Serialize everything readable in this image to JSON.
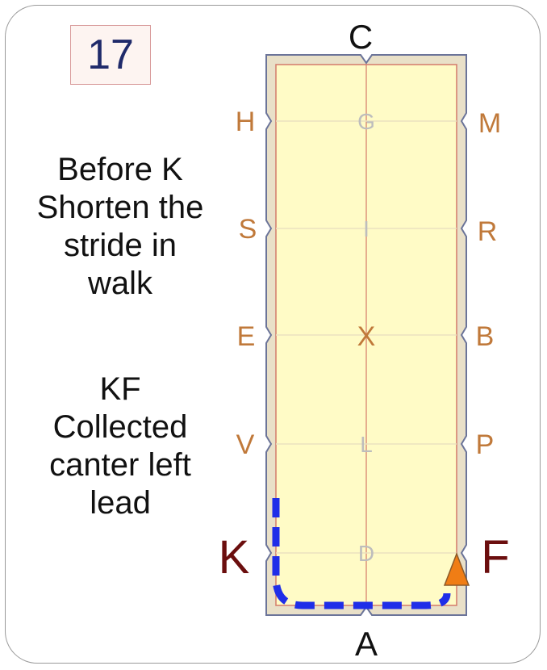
{
  "step_number": "17",
  "instructions": [
    {
      "lines": [
        "Before K",
        "Shorten the",
        "stride in",
        "walk"
      ]
    },
    {
      "lines": [
        "KF",
        "Collected",
        "canter left",
        "lead"
      ]
    }
  ],
  "arena": {
    "letters": {
      "top": "C",
      "bottom": "A",
      "left": [
        "H",
        "S",
        "E",
        "V",
        "K"
      ],
      "right": [
        "M",
        "R",
        "B",
        "P",
        "F"
      ],
      "centerline": [
        "G",
        "I",
        "X",
        "L",
        "D"
      ]
    },
    "colors": {
      "surface": "#fffbc6",
      "border": "#e9e0c8",
      "letter": "#c0793a",
      "corner_letter": "#6b0e0e",
      "centerline_letter": "#bdbdbd",
      "path": "#1f2ee8",
      "marker": "#f07d15"
    }
  }
}
